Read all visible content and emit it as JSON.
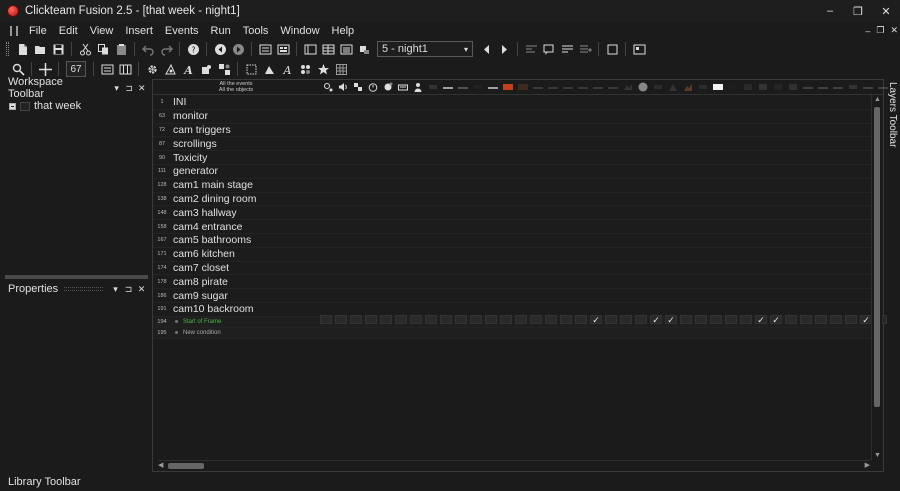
{
  "window": {
    "title": "Clickteam Fusion 2.5 - [that week - night1]",
    "controls": {
      "minimize": "–",
      "restore": "❐",
      "close": "✕"
    },
    "mdi_controls": {
      "minimize": "–",
      "restore": "❐",
      "close": "✕"
    }
  },
  "menu": [
    "File",
    "Edit",
    "View",
    "Insert",
    "Events",
    "Run",
    "Tools",
    "Window",
    "Help"
  ],
  "toolbar": {
    "frame_select": "5 - night1",
    "zoom": "67"
  },
  "workspace": {
    "title": "Workspace Toolbar",
    "tree_item": "that week"
  },
  "properties": {
    "title": "Properties"
  },
  "editor": {
    "header_line1": "All the events",
    "header_line2": "All the objects",
    "rows": [
      {
        "num": "1",
        "label": "INI"
      },
      {
        "num": "63",
        "label": "monitor"
      },
      {
        "num": "72",
        "label": "cam triggers"
      },
      {
        "num": "87",
        "label": "scrollings"
      },
      {
        "num": "90",
        "label": "Toxicity"
      },
      {
        "num": "111",
        "label": "generator"
      },
      {
        "num": "128",
        "label": "cam1 main stage"
      },
      {
        "num": "138",
        "label": "cam2 dining room"
      },
      {
        "num": "148",
        "label": "cam3 hallway"
      },
      {
        "num": "158",
        "label": "cam4 entrance"
      },
      {
        "num": "167",
        "label": "cam5 bathrooms"
      },
      {
        "num": "171",
        "label": "cam6 kitchen"
      },
      {
        "num": "174",
        "label": "cam7 closet"
      },
      {
        "num": "178",
        "label": "cam8 pirate"
      },
      {
        "num": "186",
        "label": "cam9 sugar"
      },
      {
        "num": "191",
        "label": "cam10 backroom"
      }
    ],
    "event_rows": [
      {
        "num": "194",
        "label": "Start of Frame"
      },
      {
        "num": "195",
        "label": "New condition"
      }
    ],
    "action_cells": [
      "",
      "",
      "",
      "",
      "",
      "",
      "",
      "",
      "",
      "",
      "",
      "",
      "",
      "",
      "",
      "",
      "",
      "",
      "✓",
      "",
      "",
      "",
      "✓",
      "✓",
      "",
      "",
      "",
      "",
      "",
      "✓",
      "✓",
      "",
      "",
      "",
      "",
      "",
      "✓",
      ""
    ]
  },
  "layers_toolbar": "Layers Toolbar",
  "library_toolbar": "Library Toolbar"
}
